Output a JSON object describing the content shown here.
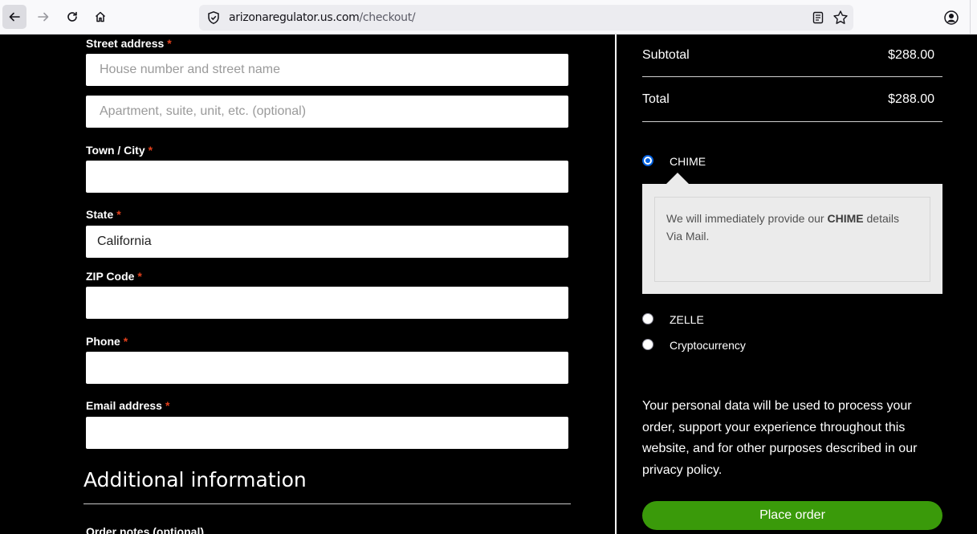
{
  "browser": {
    "url_host": "arizonaregulator.us.com",
    "url_path": "/checkout/"
  },
  "form": {
    "street_label": "Street address",
    "street_placeholder": "House number and street name",
    "apartment_placeholder": "Apartment, suite, unit, etc. (optional)",
    "city_label": "Town / City",
    "city_value": "",
    "state_label": "State",
    "state_value": "California",
    "zip_label": "ZIP Code",
    "zip_value": "",
    "phone_label": "Phone",
    "phone_value": "",
    "email_label": "Email address",
    "email_value": "",
    "required_mark": "*",
    "additional_title": "Additional information",
    "notes_label": "Order notes (optional)"
  },
  "order": {
    "subtotal_label": "Subtotal",
    "subtotal_value": "$288.00",
    "total_label": "Total",
    "total_value": "$288.00"
  },
  "payment": {
    "selected": "CHIME",
    "methods": [
      {
        "label": "CHIME",
        "checked": true
      },
      {
        "label": "ZELLE",
        "checked": false
      },
      {
        "label": "Cryptocurrency",
        "checked": false
      }
    ],
    "desc_prefix": "We will immediately provide our ",
    "desc_bold": "CHIME",
    "desc_suffix": " details Via Mail."
  },
  "privacy_text": "Your personal data will be used to process your order, support your experience throughout this website, and for other purposes described in our privacy policy.",
  "place_order_label": "Place order",
  "colors": {
    "accent_green": "#3a9a0a",
    "required_red": "#e2401c",
    "radio_blue": "#0060df"
  }
}
